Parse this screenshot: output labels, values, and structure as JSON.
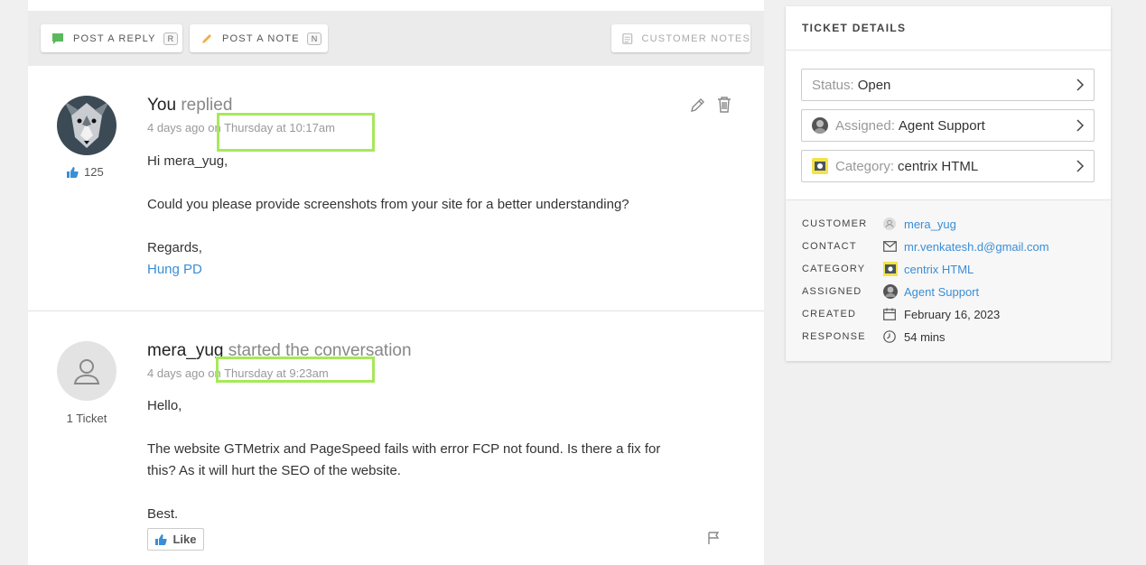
{
  "toolbar": {
    "reply_label": "POST A REPLY",
    "reply_key": "R",
    "note_label": "POST A NOTE",
    "note_key": "N",
    "customer_notes_label": "CUSTOMER NOTES"
  },
  "messages": [
    {
      "author": "You",
      "action": "replied",
      "meta_prefix": "4 days ago on",
      "meta_time": "Thursday at 10:17am",
      "likes": "125",
      "body": [
        "Hi mera_yug,",
        "Could you please provide screenshots from your site for a better understanding?",
        "Regards,"
      ],
      "signature": "Hung PD"
    },
    {
      "author": "mera_yug",
      "action": "started the conversation",
      "meta_prefix": "4 days ago on",
      "meta_time": "Thursday at 9:23am",
      "tickets": "1 Ticket",
      "body": [
        "Hello,",
        "The website GTMetrix and PageSpeed fails with error FCP not found. Is there a fix for this? As it will hurt the SEO of the website.",
        "Best."
      ],
      "like_label": "Like"
    }
  ],
  "sidebar": {
    "title": "TICKET DETAILS",
    "status_key": "Status:",
    "status_value": "Open",
    "assigned_key": "Assigned:",
    "assigned_value": "Agent Support",
    "category_key": "Category:",
    "category_value": "centrix HTML",
    "details": [
      {
        "label": "CUSTOMER",
        "value": "mera_yug"
      },
      {
        "label": "CONTACT",
        "value": "mr.venkatesh.d@gmail.com"
      },
      {
        "label": "CATEGORY",
        "value": "centrix HTML"
      },
      {
        "label": "ASSIGNED",
        "value": "Agent Support"
      },
      {
        "label": "CREATED",
        "value": "February 16, 2023"
      },
      {
        "label": "RESPONSE",
        "value": "54 mins"
      }
    ]
  },
  "colors": {
    "accent_link": "#3a8ed6",
    "highlight": "#a6e85b",
    "reply_icon": "#5cb85c",
    "note_icon": "#f0ad4e"
  },
  "icons": [
    "comment-icon",
    "pencil-icon",
    "notes-icon",
    "edit-icon",
    "trash-icon",
    "thumbs-up-icon",
    "user-icon",
    "flag-icon",
    "chevron-right-icon",
    "user-small-icon",
    "mail-icon",
    "calendar-icon",
    "clock-icon"
  ]
}
